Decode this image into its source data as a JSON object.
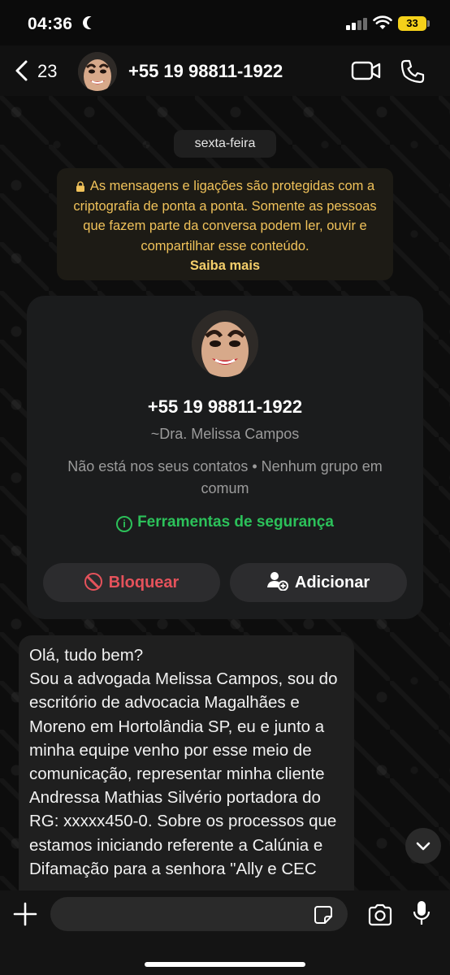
{
  "status_bar": {
    "time": "04:36",
    "battery": "33"
  },
  "header": {
    "back_count": "23",
    "title": "+55 19 98811-1922"
  },
  "chat": {
    "date_label": "sexta-feira",
    "encryption_notice": "As mensagens e ligações são protegidas com a criptografia de ponta a ponta. Somente as pessoas que fazem parte da conversa podem ler, ouvir e compartilhar esse conteúdo.",
    "encryption_learn_more": "Saiba mais"
  },
  "contact_card": {
    "phone": "+55 19 98811-1922",
    "push_name": "~Dra. Melissa Campos",
    "info": "Não está nos seus contatos • Nenhum grupo em comum",
    "safety_tools": "Ferramentas de segurança",
    "block_label": "Bloquear",
    "add_label": "Adicionar"
  },
  "message": {
    "text": "Olá, tudo bem?\nSou a advogada Melissa Campos, sou do escritório de advocacia Magalhães e Moreno em Hortolândia SP, eu e junto a minha equipe venho por esse meio de comunicação, representar minha cliente Andressa Mathias Silvério portadora do RG: xxxxx450-0. Sobre os processos que estamos iniciando referente a Calúnia e Difamação para a senhora \"Ally e CEC"
  },
  "composer": {
    "placeholder": ""
  },
  "colors": {
    "accent_green": "#2cc15a",
    "danger_red": "#e5525b",
    "notice_yellow": "#f0c25a",
    "battery_yellow": "#f5d11a"
  },
  "icons": [
    "moon-icon",
    "signal-icon",
    "wifi-icon",
    "battery-icon",
    "back-chevron-icon",
    "video-call-icon",
    "phone-call-icon",
    "lock-icon",
    "info-icon",
    "block-icon",
    "add-user-icon",
    "chevron-down-icon",
    "plus-icon",
    "sticker-icon",
    "camera-icon",
    "mic-icon"
  ]
}
